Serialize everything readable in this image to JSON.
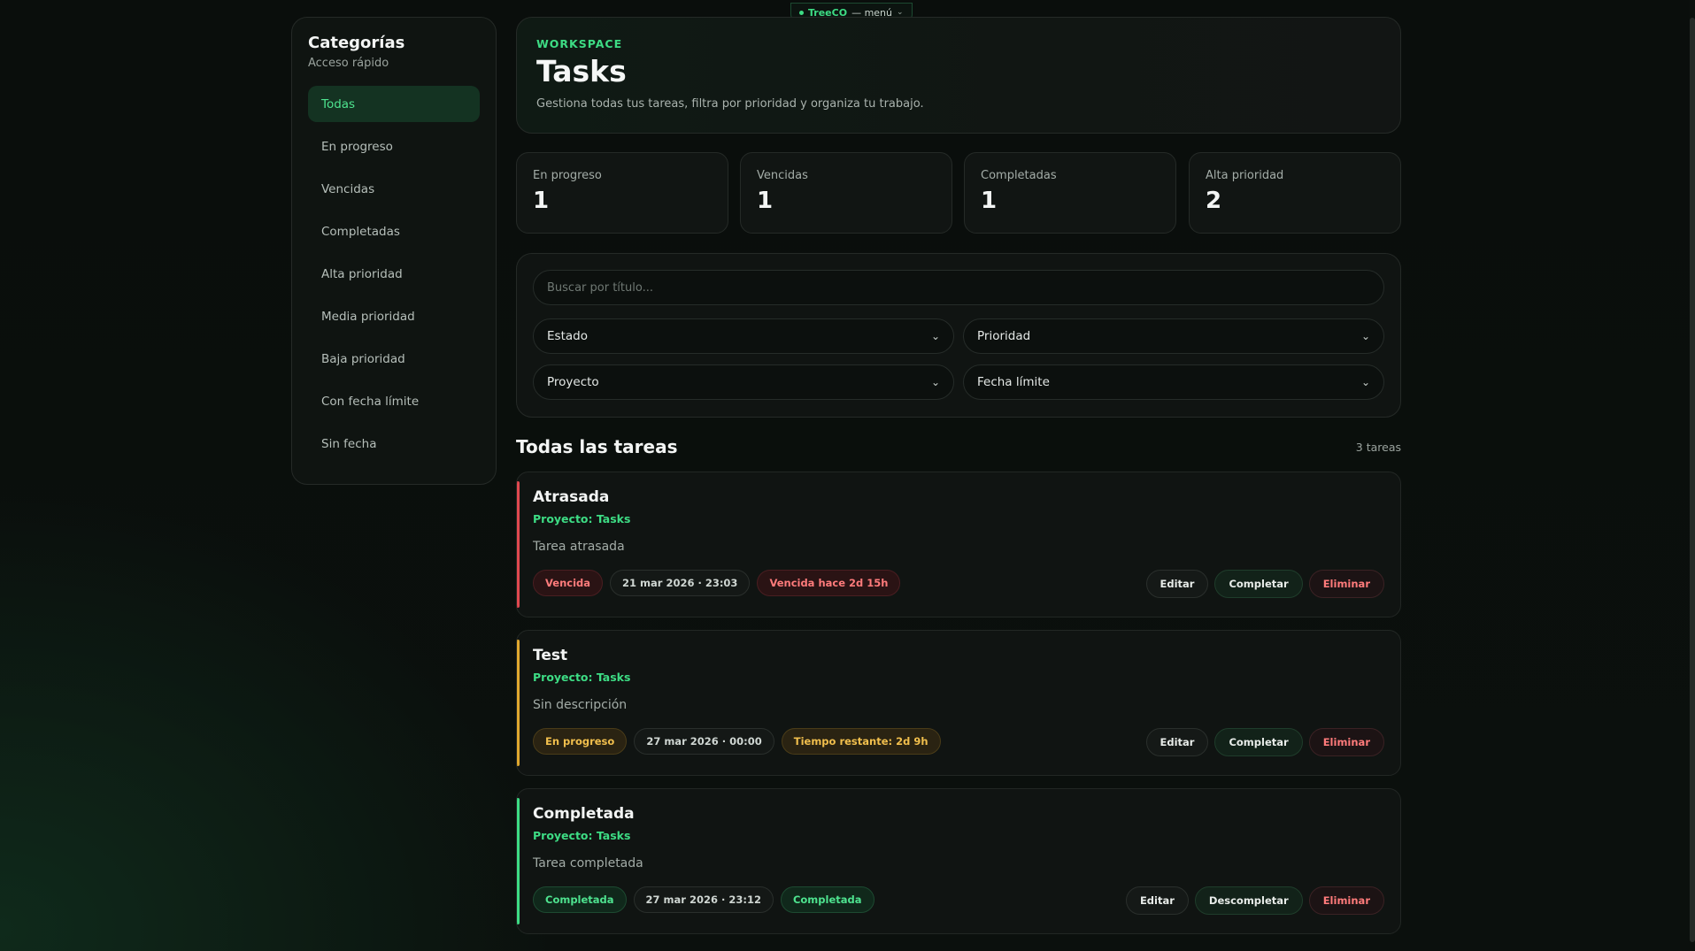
{
  "top_menu": {
    "brand": "TreeCO",
    "suffix": "— menú",
    "chevron": "chevron-down-icon"
  },
  "sidebar": {
    "title": "Categorías",
    "subtitle": "Acceso rápido",
    "items": [
      {
        "label": "Todas",
        "active": true
      },
      {
        "label": "En progreso"
      },
      {
        "label": "Vencidas"
      },
      {
        "label": "Completadas"
      },
      {
        "label": "Alta prioridad"
      },
      {
        "label": "Media prioridad"
      },
      {
        "label": "Baja prioridad"
      },
      {
        "label": "Con fecha límite"
      },
      {
        "label": "Sin fecha"
      }
    ]
  },
  "header": {
    "eyebrow": "WORKSPACE",
    "title": "Tasks",
    "description": "Gestiona todas tus tareas, filtra por prioridad y organiza tu trabajo."
  },
  "stats": [
    {
      "label": "En progreso",
      "value": "1"
    },
    {
      "label": "Vencidas",
      "value": "1"
    },
    {
      "label": "Completadas",
      "value": "1"
    },
    {
      "label": "Alta prioridad",
      "value": "2"
    }
  ],
  "filters": {
    "search_placeholder": "Buscar por título...",
    "estado": "Estado",
    "prioridad": "Prioridad",
    "proyecto": "Proyecto",
    "fecha": "Fecha límite"
  },
  "list": {
    "title": "Todas las tareas",
    "count": "3 tareas"
  },
  "colors": {
    "accent": "#3ddc84",
    "overdue": "#e0484f",
    "in_progress": "#e0a82e",
    "done": "#3ddc84"
  },
  "tasks": [
    {
      "title": "Atrasada",
      "project": "Proyecto: Tasks",
      "description": "Tarea atrasada",
      "status": "Vencida",
      "date": "21 mar 2026 · 23:03",
      "time_info": "Vencida hace 2d 15h",
      "edit": "Editar",
      "toggle": "Completar",
      "delete": "Eliminar"
    },
    {
      "title": "Test",
      "project": "Proyecto: Tasks",
      "description": "Sin descripción",
      "status": "En progreso",
      "date": "27 mar 2026 · 00:00",
      "time_info": "Tiempo restante: 2d 9h",
      "edit": "Editar",
      "toggle": "Completar",
      "delete": "Eliminar"
    },
    {
      "title": "Completada",
      "project": "Proyecto: Tasks",
      "description": "Tarea completada",
      "status": "Completada",
      "date": "27 mar 2026 · 23:12",
      "time_info": "Completada",
      "edit": "Editar",
      "toggle": "Descompletar",
      "delete": "Eliminar"
    }
  ]
}
